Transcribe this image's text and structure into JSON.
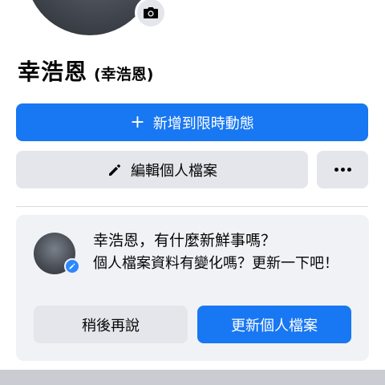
{
  "profile": {
    "name": "幸浩恩",
    "alt_name": "(幸浩恩)",
    "photo_icon": "camera-icon"
  },
  "actions": {
    "add_story_label": "新增到限時動態",
    "add_story_icon": "plus-icon",
    "edit_profile_label": "編輯個人檔案",
    "edit_profile_icon": "pencil-icon",
    "more_icon": "more-dots-icon"
  },
  "prompt_card": {
    "title": "幸浩恩，有什麼新鮮事嗎？",
    "subtitle": "個人檔案資料有變化嗎？更新一下吧！",
    "later_label": "稍後再說",
    "update_label": "更新個人檔案",
    "badge_icon": "pencil-badge-icon"
  },
  "colors": {
    "primary": "#1877f2",
    "secondary_button": "#e4e6eb",
    "card_bg": "#f0f2f5",
    "text": "#050505"
  }
}
